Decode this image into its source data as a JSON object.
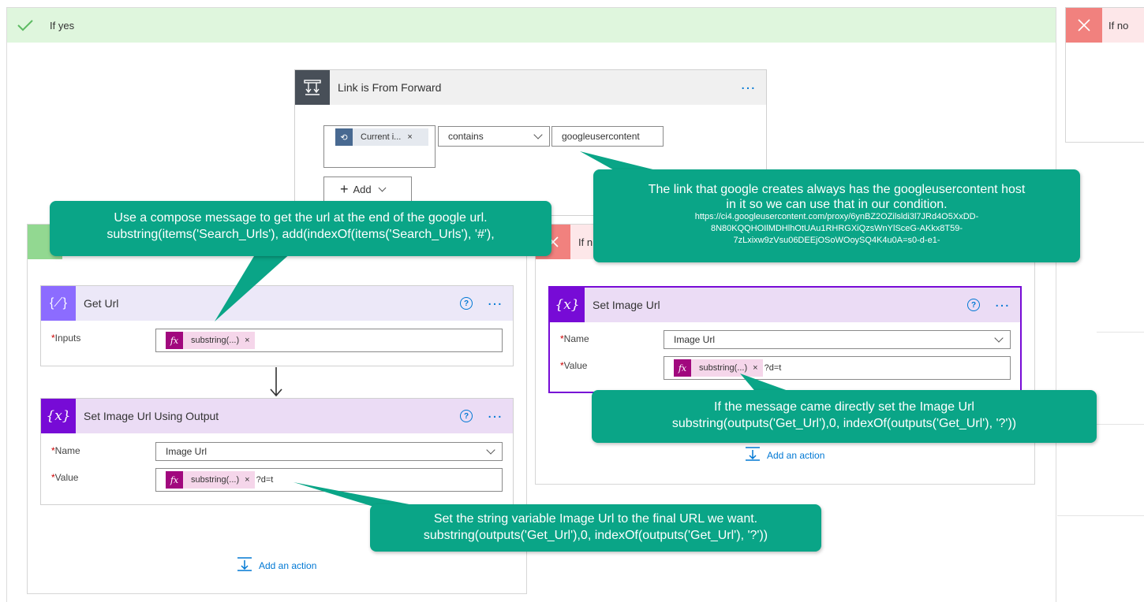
{
  "if_yes": {
    "label": "If yes"
  },
  "if_no": {
    "label": "If no"
  },
  "inner_no": {
    "label": "If n"
  },
  "condition": {
    "title": "Link is From Forward",
    "token_label": "Current i...",
    "operator": "contains",
    "value": "googleusercontent",
    "add_label": "Add"
  },
  "get_url": {
    "title": "Get Url",
    "inputs_label": "Inputs",
    "token_label": "substring(...)"
  },
  "set_image_url_output": {
    "title": "Set Image Url Using Output",
    "name_label": "Name",
    "name_value": "Image Url",
    "value_label": "Value",
    "token_label": "substring(...)",
    "suffix": "?d=t"
  },
  "set_image_url": {
    "title": "Set Image Url",
    "name_label": "Name",
    "name_value": "Image Url",
    "value_label": "Value",
    "token_label": "substring(...)",
    "suffix": "?d=t"
  },
  "add_action_label": "Add an action",
  "callouts": {
    "compose": [
      "Use a compose message to get the url at the end of the google url.",
      "substring(items('Search_Urls'), add(indexOf(items('Search_Urls'), '#'),"
    ],
    "link": {
      "main": [
        "The link that google creates always has the googleusercontent host",
        "in it so we can use that in our condition."
      ],
      "url": [
        "https://ci4.googleusercontent.com/proxy/6ynBZ2OZilsldi3l7JRd4O5XxDD-",
        "8N80KQQHOIlMDHlhOtUAu1RHRGXiQzsWnYlSceG-AKkx8T59-",
        "7zLxixw9zVsu06DEEjOSoWOoySQ4K4u0A=s0-d-e1-"
      ]
    },
    "direct": [
      "If the message came directly set the Image Url",
      "substring(outputs('Get_Url'),0, indexOf(outputs('Get_Url'), '?'))"
    ],
    "final": [
      "Set the string variable Image Url to the final URL we want.",
      "substring(outputs('Get_Url'),0, indexOf(outputs('Get_Url'), '?'))"
    ]
  },
  "colors": {
    "yes_green": "#dff6dd",
    "yes_check": "#92d891",
    "no_red": "#fde7e9",
    "no_x": "#f1817e",
    "condition_dark": "#484f58",
    "compose_purple": "#8c6cff",
    "variable_purple": "#770bd6",
    "callout_green": "#0aa587"
  }
}
